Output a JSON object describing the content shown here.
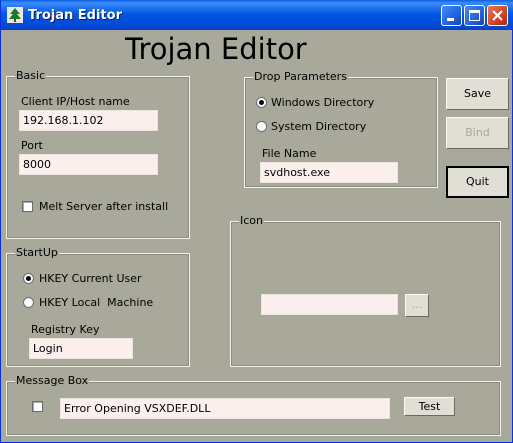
{
  "window": {
    "title": "Trojan Editor",
    "icon": "tree-icon",
    "controls": [
      "minimize-icon",
      "maximize-icon",
      "close-icon"
    ]
  },
  "heading": "Trojan Editor",
  "basic": {
    "group_label": "Basic",
    "host_label": "Client IP/Host name",
    "host_value": "192.168.1.102",
    "port_label": "Port",
    "port_value": "8000",
    "melt_label": "Melt Server after install",
    "melt_checked": false
  },
  "startup": {
    "group_label": "StartUp",
    "options": [
      {
        "label": "HKEY Current User",
        "selected": true
      },
      {
        "label": "HKEY Local  Machine",
        "selected": false
      }
    ],
    "registry_label": "Registry Key",
    "registry_value": "Login"
  },
  "drop": {
    "group_label": "Drop Parameters",
    "options": [
      {
        "label": "Windows Directory",
        "selected": true
      },
      {
        "label": "System Directory",
        "selected": false
      }
    ],
    "file_label": "File Name",
    "file_value": "svdhost.exe"
  },
  "buttons": {
    "save": "Save",
    "bind": "Bind",
    "quit": "Quit"
  },
  "icon_group": {
    "group_label": "Icon",
    "path_value": "",
    "browse_label": "..."
  },
  "message_box": {
    "group_label": "Message Box",
    "enabled": false,
    "text": "Error Opening VSXDEF.DLL",
    "test_label": "Test"
  },
  "colors": {
    "titlebar": "#0058e6",
    "window_bg": "#a9a99b",
    "field_bg": "#fbf0ee",
    "close_button": "#d2431e"
  }
}
